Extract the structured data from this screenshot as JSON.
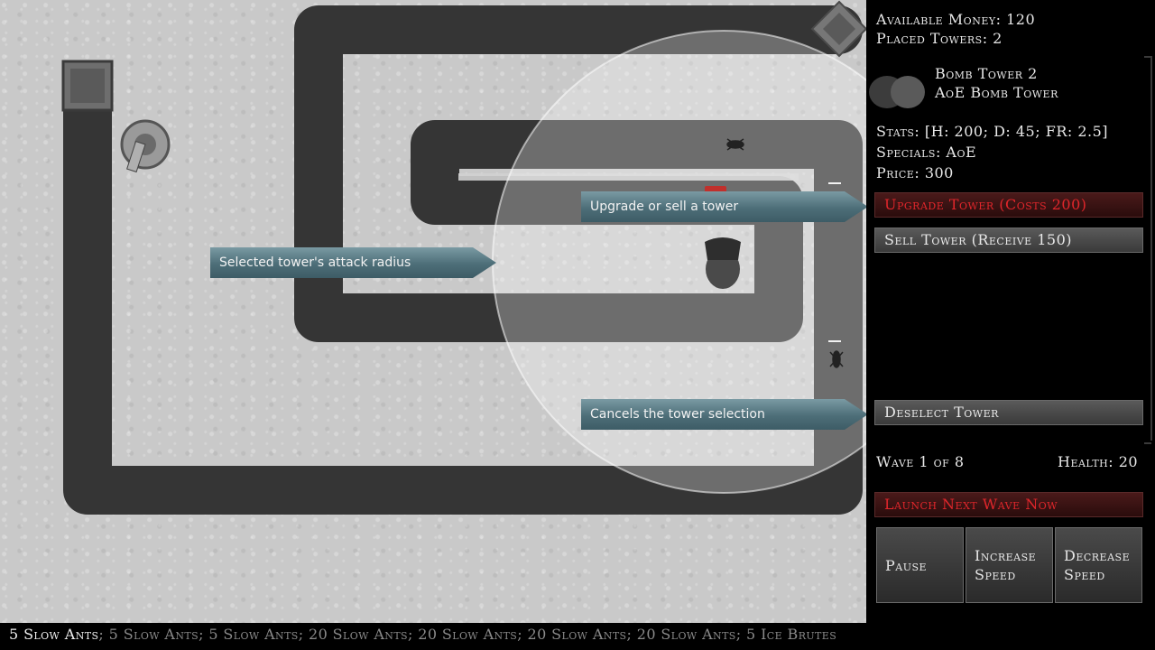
{
  "map": {
    "callouts": {
      "attack_radius": "Selected tower's attack radius",
      "upgrade_sell": "Upgrade or sell a tower",
      "cancel_selection": "Cancels the tower selection"
    }
  },
  "panel": {
    "available_money_label": "Available Money: 120",
    "placed_towers_label": "Placed Towers: 2",
    "tower_name": "Bomb Tower 2",
    "tower_type": "AoE Bomb Tower",
    "stats": "Stats: [H: 200; D: 45; FR: 2.5]",
    "specials": "Specials: AoE",
    "price": "Price: 300",
    "upgrade_button": "Upgrade Tower (Costs 200)",
    "sell_button": "Sell Tower (Receive 150)",
    "deselect_button": "Deselect Tower",
    "wave_label": "Wave 1 of 8",
    "health_label": "Health: 20",
    "launch_button": "Launch Next Wave Now",
    "pause_button": "Pause",
    "increase_speed_button": "Increase\nSpeed",
    "decrease_speed_button": "Decrease\nSpeed"
  },
  "waves": {
    "current": "5 Slow Ants",
    "upcoming": "; 5 Slow Ants; 5 Slow Ants; 20 Slow Ants; 20 Slow Ants; 20 Slow Ants; 20 Slow Ants; 5 Ice Brutes"
  },
  "colors": {
    "path": "#333333",
    "panel_bg": "#000000",
    "red_text": "#e0262b",
    "callout": "#4d6e78"
  }
}
